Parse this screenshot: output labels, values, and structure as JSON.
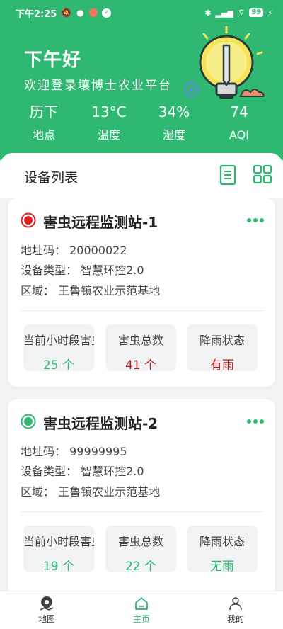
{
  "status_bar": {
    "time": "下午2:25",
    "battery": "99"
  },
  "header": {
    "greeting": "下午好",
    "welcome": "欢迎登录壤博士农业平台",
    "stats": [
      {
        "value": "历下",
        "label": "地点"
      },
      {
        "value": "13°C",
        "label": "温度"
      },
      {
        "value": "34%",
        "label": "湿度"
      },
      {
        "value": "74",
        "label": "AQI"
      }
    ]
  },
  "panel": {
    "title": "设备列表"
  },
  "devices": [
    {
      "name": "害虫远程监测站-1",
      "status_color": "#e02020",
      "address": "地址码：  20000022",
      "type": "设备类型：  智慧环控2.0",
      "region": "区域：  王鲁镇农业示范基地",
      "boxes": [
        {
          "title": "当前小时段害虫",
          "value": "25 个",
          "color": "green"
        },
        {
          "title": "害虫总数",
          "value": "41 个",
          "color": "red"
        },
        {
          "title": "降雨状态",
          "value": "有雨",
          "color": "red"
        }
      ]
    },
    {
      "name": "害虫远程监测站-2",
      "status_color": "#2eb872",
      "address": "地址码：  99999995",
      "type": "设备类型：  智慧环控2.0",
      "region": "区域：  王鲁镇农业示范基地",
      "boxes": [
        {
          "title": "当前小时段害虫",
          "value": "19 个",
          "color": "green"
        },
        {
          "title": "害虫总数",
          "value": "22 个",
          "color": "green"
        },
        {
          "title": "降雨状态",
          "value": "无雨",
          "color": "green"
        }
      ]
    }
  ],
  "nav": {
    "map": "地图",
    "home": "主页",
    "mine": "我的"
  },
  "colors": {
    "brand": "#2eb872",
    "alert": "#b51f1f"
  }
}
